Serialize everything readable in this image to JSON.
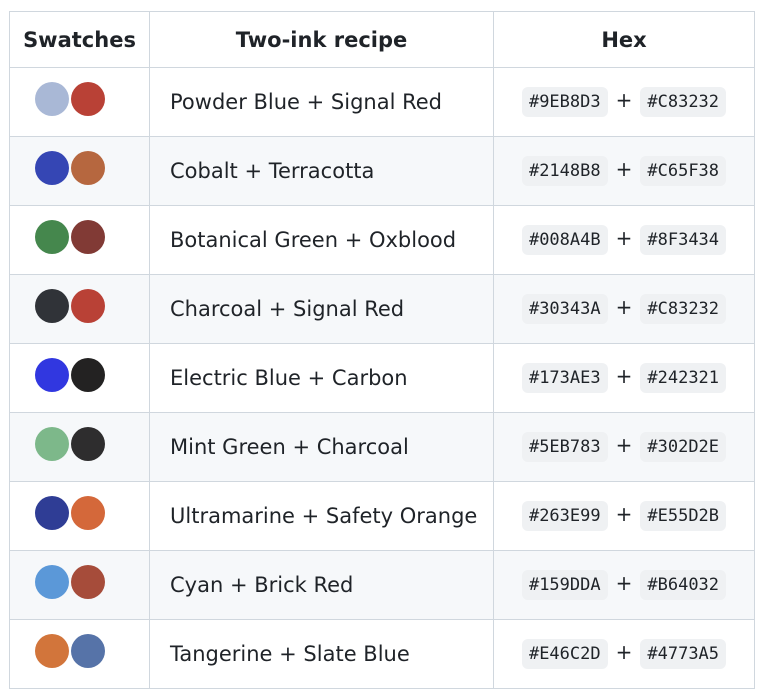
{
  "table": {
    "headers": [
      "Swatches",
      "Two-ink recipe",
      "Hex"
    ],
    "rows": [
      {
        "recipe": "Powder Blue + Signal Red",
        "hex1": "#9EB8D3",
        "hex2": "#C83232",
        "c1": "#A9B8D6",
        "c2": "#B94136"
      },
      {
        "recipe": "Cobalt + Terracotta",
        "hex1": "#2148B8",
        "hex2": "#C65F38",
        "c1": "#3546B4",
        "c2": "#B6673F"
      },
      {
        "recipe": "Botanical Green + Oxblood",
        "hex1": "#008A4B",
        "hex2": "#8F3434",
        "c1": "#45874D",
        "c2": "#813A35"
      },
      {
        "recipe": "Charcoal + Signal Red",
        "hex1": "#30343A",
        "hex2": "#C83232",
        "c1": "#303338",
        "c2": "#B94136"
      },
      {
        "recipe": "Electric Blue + Carbon",
        "hex1": "#173AE3",
        "hex2": "#242321",
        "c1": "#3137E0",
        "c2": "#232222"
      },
      {
        "recipe": "Mint Green + Charcoal",
        "hex1": "#5EB783",
        "hex2": "#302D2E",
        "c1": "#7DB88A",
        "c2": "#2E2D2E"
      },
      {
        "recipe": "Ultramarine + Safety Orange",
        "hex1": "#263E99",
        "hex2": "#E55D2B",
        "c1": "#2F3D95",
        "c2": "#D4683A"
      },
      {
        "recipe": "Cyan + Brick Red",
        "hex1": "#159DDA",
        "hex2": "#B64032",
        "c1": "#5B98D8",
        "c2": "#A64C3A"
      },
      {
        "recipe": "Tangerine + Slate Blue",
        "hex1": "#E46C2D",
        "hex2": "#4773A5",
        "c1": "#D2753B",
        "c2": "#5673A8"
      }
    ]
  }
}
